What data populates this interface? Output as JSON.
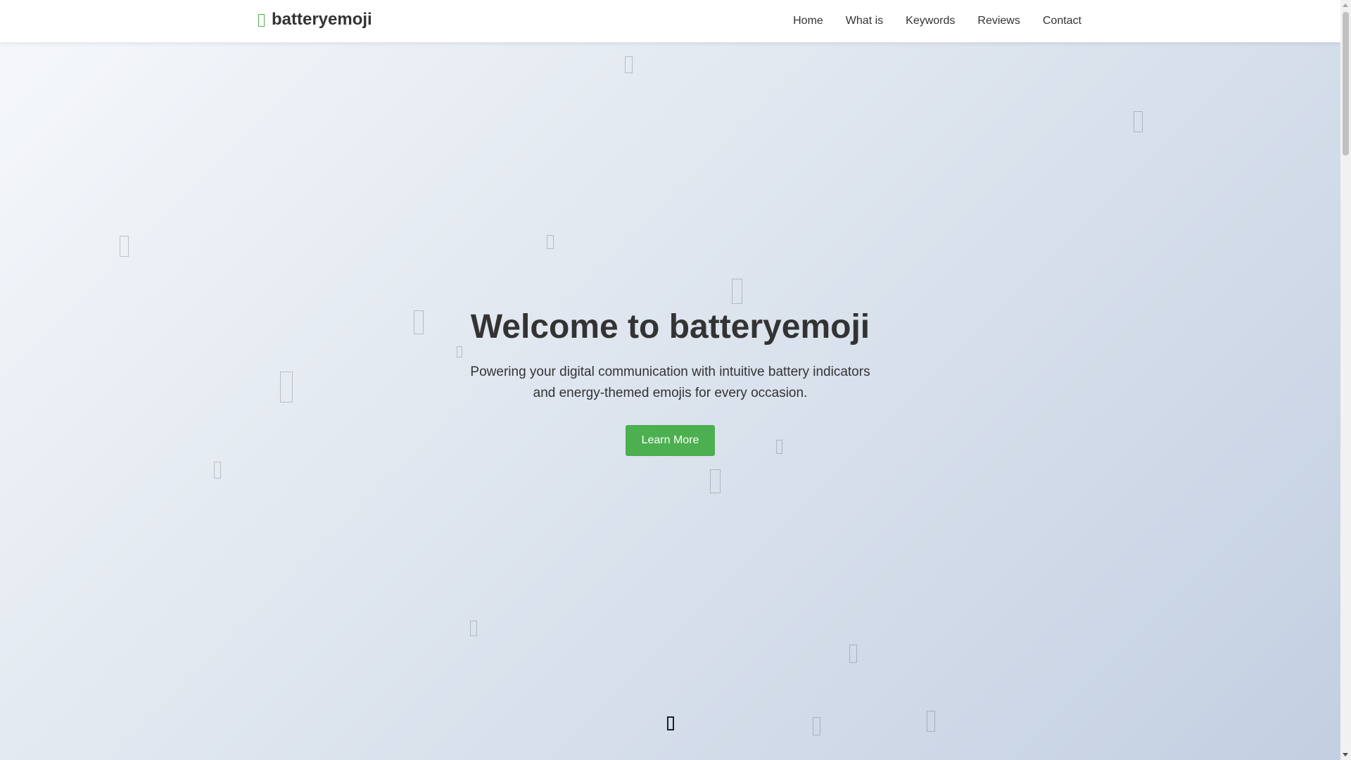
{
  "header": {
    "logo_icon": "battery-icon",
    "logo_text": "batteryemoji",
    "nav": [
      {
        "label": "Home"
      },
      {
        "label": "What is"
      },
      {
        "label": "Keywords"
      },
      {
        "label": "Reviews"
      },
      {
        "label": "Contact"
      }
    ]
  },
  "hero": {
    "title": "Welcome to batteryemoji",
    "subtitle": "Powering your digital communication with intuitive battery indicators and energy-themed emojis for every occasion.",
    "cta_label": "Learn More"
  },
  "decor": {
    "floating_icon": "battery-icon",
    "scroll_icon": "battery-icon"
  },
  "colors": {
    "accent": "#4CAF50",
    "text": "#333333",
    "header_bg": "#ffffff"
  }
}
